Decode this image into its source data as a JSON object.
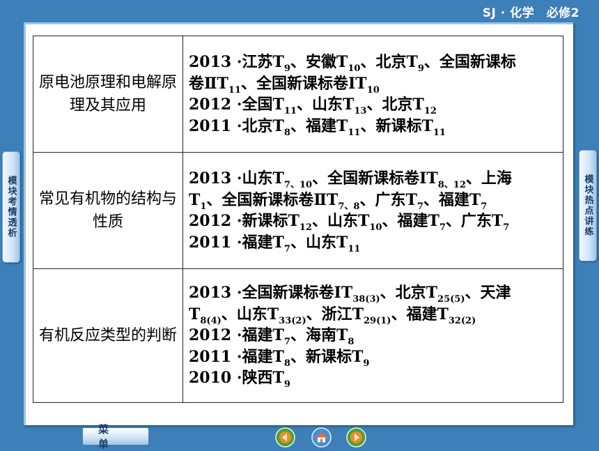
{
  "header": {
    "brand": "SJ · 化学　必修2"
  },
  "side_tabs": {
    "left_label": "模块考情透析",
    "right_label": "模块热点讲练"
  },
  "table": {
    "rows": [
      {
        "topic": "原电池原理和电解原理及其应用",
        "lines": [
          [
            [
              "2013 ·江苏T",
              ""
            ],
            [
              "9",
              ""
            ],
            [
              "、安徽T",
              ""
            ],
            [
              "10",
              ""
            ],
            [
              "、北京T",
              ""
            ],
            [
              "9",
              ""
            ],
            [
              "、全国新课标",
              ""
            ]
          ],
          [
            [
              "卷ⅡT",
              ""
            ],
            [
              "11",
              ""
            ],
            [
              "、全国新课标卷ⅠT",
              ""
            ],
            [
              "10",
              ""
            ]
          ],
          [
            [
              "2012 ·全国T",
              ""
            ],
            [
              "11",
              ""
            ],
            [
              "、山东T",
              ""
            ],
            [
              "13",
              ""
            ],
            [
              "、北京T",
              ""
            ],
            [
              "12",
              ""
            ]
          ],
          [
            [
              "2011 ·北京T",
              ""
            ],
            [
              "8",
              ""
            ],
            [
              "、福建T",
              ""
            ],
            [
              "11",
              ""
            ],
            [
              "、新课标T",
              ""
            ],
            [
              "11",
              ""
            ]
          ]
        ]
      },
      {
        "topic": "常见有机物的结构与性质",
        "lines": [
          [
            [
              "2013 ·山东T",
              ""
            ],
            [
              "7、10",
              ""
            ],
            [
              "、全国新课标卷ⅠT",
              ""
            ],
            [
              "8、12",
              ""
            ],
            [
              "、上海",
              ""
            ]
          ],
          [
            [
              "T",
              ""
            ],
            [
              "1",
              ""
            ],
            [
              "、全国新课标卷ⅡT",
              ""
            ],
            [
              "7、8",
              ""
            ],
            [
              "、广东T",
              ""
            ],
            [
              "7",
              ""
            ],
            [
              "、福建T",
              ""
            ],
            [
              "7",
              ""
            ]
          ],
          [
            [
              "2012 ·新课标T",
              ""
            ],
            [
              "12",
              ""
            ],
            [
              "、山东T",
              ""
            ],
            [
              "10",
              ""
            ],
            [
              "、福建T",
              ""
            ],
            [
              "7",
              ""
            ],
            [
              "、广东T",
              ""
            ],
            [
              "7",
              ""
            ]
          ],
          [
            [
              "2011 ·福建T",
              ""
            ],
            [
              "7",
              ""
            ],
            [
              "、山东T",
              ""
            ],
            [
              "11",
              ""
            ]
          ]
        ]
      },
      {
        "topic": "有机反应类型的判断",
        "lines": [
          [
            [
              "2013 ·全国新课标卷ⅠT",
              ""
            ],
            [
              "38(3)",
              ""
            ],
            [
              "、北京T",
              ""
            ],
            [
              "25(5)",
              ""
            ],
            [
              "、天津",
              ""
            ]
          ],
          [
            [
              "T",
              ""
            ],
            [
              "8(4)",
              ""
            ],
            [
              "、山东T",
              ""
            ],
            [
              "33(2)",
              ""
            ],
            [
              "、浙江T",
              ""
            ],
            [
              "29(1)",
              ""
            ],
            [
              "、福建T",
              ""
            ],
            [
              "32(2)",
              ""
            ]
          ],
          [
            [
              "2012 ·福建T",
              ""
            ],
            [
              "7",
              ""
            ],
            [
              "、海南T",
              ""
            ],
            [
              "8",
              ""
            ]
          ],
          [
            [
              "2011 ·福建T",
              ""
            ],
            [
              "8",
              ""
            ],
            [
              "、新课标T",
              ""
            ],
            [
              "9",
              ""
            ]
          ],
          [
            [
              "2010 ·陕西T",
              ""
            ],
            [
              "9",
              ""
            ]
          ]
        ]
      }
    ]
  },
  "footer": {
    "menu_label": "菜单",
    "nav": [
      "prev-icon",
      "home-icon",
      "next-icon"
    ]
  },
  "colors": {
    "background": "#3d7fb8",
    "panel": "#ffffff",
    "nav_green": "#4aa23a",
    "nav_orange": "#f08a2a"
  }
}
